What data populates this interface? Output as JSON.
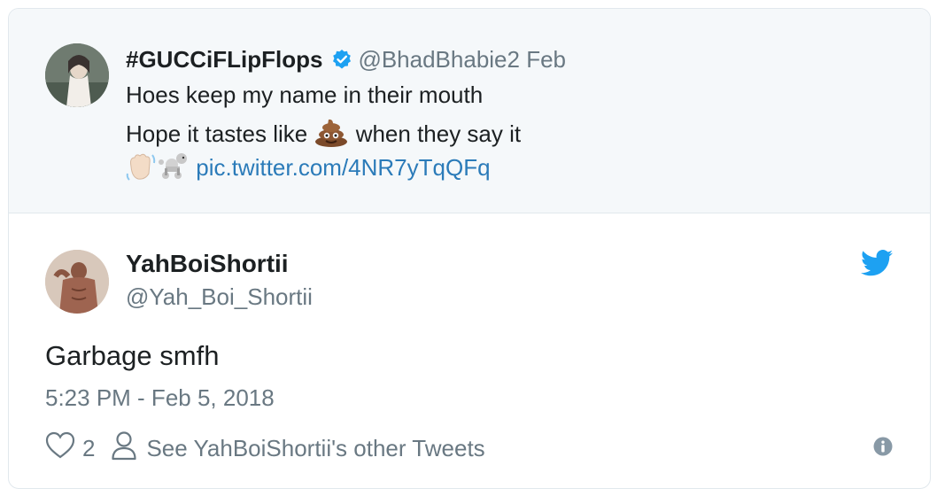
{
  "quoted_tweet": {
    "display_name": "#GUCCiFLipFlops",
    "handle_date": "@BhadBhabie2 Feb",
    "line1": "Hoes keep my name in their mouth",
    "line2_before": "Hope it tastes like",
    "line2_after": "when they say it",
    "link": "pic.twitter.com/4NR7yTqQFq",
    "icons": [
      "verified-badge-icon",
      "poop-emoji-icon",
      "waving-hand-emoji-icon",
      "poodle-emoji-icon"
    ]
  },
  "tweet": {
    "display_name": "YahBoiShortii",
    "handle": "@Yah_Boi_Shortii",
    "text": "Garbage smfh",
    "timestamp": "5:23 PM - Feb 5, 2018",
    "like_count": "2",
    "other_tweets_label": "See YahBoiShortii's other Tweets"
  },
  "colors": {
    "link": "#2b7bb9",
    "twitter_blue": "#1da1f2",
    "secondary_text": "#697882",
    "quoted_background": "#f5f8fa"
  }
}
